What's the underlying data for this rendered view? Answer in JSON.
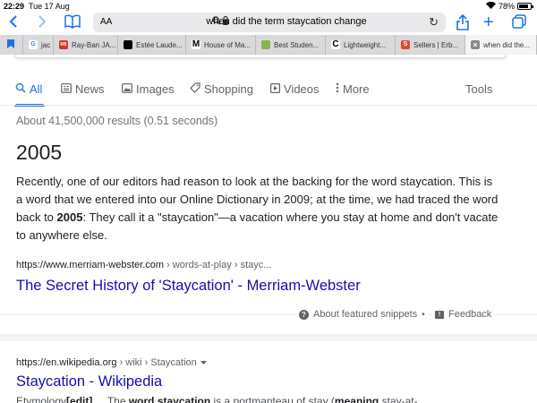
{
  "status_bar": {
    "time": "22:29",
    "date": "Tue 17 Aug",
    "battery": "78%"
  },
  "toolbar": {
    "aa_label": "AA",
    "url_text": "when did the term staycation change"
  },
  "tabs": [
    {
      "label": "jac",
      "icon": "google-favicon",
      "color": "#4285f4",
      "glyph": "G"
    },
    {
      "label": "Ray-Ban JA...",
      "icon": "rayban-favicon",
      "color": "#d93025",
      "glyph": "RB"
    },
    {
      "label": "Estée Laude...",
      "icon": "estee-favicon",
      "color": "#000000",
      "glyph": ""
    },
    {
      "label": "House of Ma...",
      "icon": "m-favicon",
      "color": "#000000",
      "glyph": "M"
    },
    {
      "label": "Best Studen...",
      "icon": "image-favicon",
      "color": "#8ab34a",
      "glyph": ""
    },
    {
      "label": "Lightweight...",
      "icon": "c-favicon",
      "color": "#000000",
      "glyph": "C"
    },
    {
      "label": "Sellers | Erb...",
      "icon": "erb-favicon",
      "color": "#e04a2f",
      "glyph": "S"
    },
    {
      "label": "when did the...",
      "icon": "close-icon",
      "color": "#888888",
      "glyph": "×"
    }
  ],
  "nav": {
    "all": "All",
    "news": "News",
    "images": "Images",
    "shopping": "Shopping",
    "videos": "Videos",
    "more": "More",
    "tools": "Tools"
  },
  "result_stats": "About 41,500,000 results (0.51 seconds)",
  "featured_snippet": {
    "answer": "2005",
    "text_before": "Recently, one of our editors had reason to look at the backing for the word staycation. This is a word that we entered into our Online Dictionary in 2009; at the time, we had traced the word back to ",
    "text_bold": "2005",
    "text_after": ": They call it a \"staycation\"—a vacation where you stay at home and don't vacate to anywhere else.",
    "cite_domain": "https://www.merriam-webster.com",
    "cite_path": " › words-at-play › stayc...",
    "title": "The Secret History of 'Staycation' - Merriam-Webster",
    "about_label": "About featured snippets",
    "feedback_label": "Feedback"
  },
  "result2": {
    "cite_domain": "https://en.wikipedia.org",
    "cite_path": " › wiki › Staycation",
    "title": "Staycation - Wikipedia",
    "desc_a": "Etymology",
    "desc_b": "[edit]",
    "desc_c": " ... The ",
    "desc_d": "word staycation",
    "desc_e": " is a portmanteau of stay (",
    "desc_f": "meaning",
    "desc_g": " stay-at-"
  },
  "colors": {
    "accent": "#1a73e8",
    "link": "#1a0dab"
  }
}
